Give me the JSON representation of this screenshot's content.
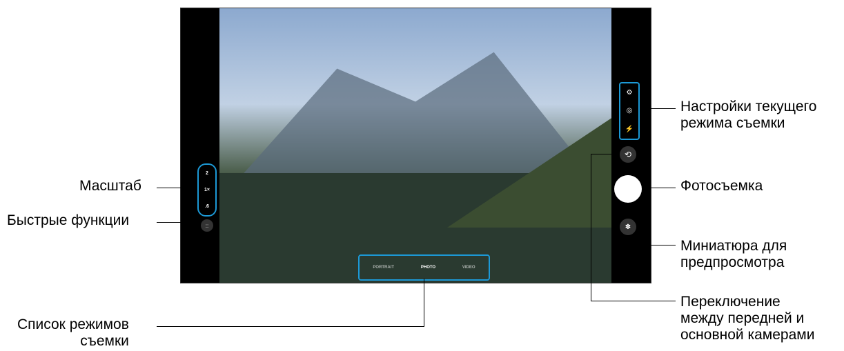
{
  "labels": {
    "zoom": "Масштаб",
    "quick_funcs": "Быстрые функции",
    "mode_list": "Список режимов\nсъемки",
    "settings": "Настройки текущего\nрежима съемки",
    "capture": "Фотосъемка",
    "thumbnail": "Миниатюра для\nпредпросмотра",
    "switch_camera": "Переключение\nмежду передней и\nосновной камерами"
  },
  "ui_values": {
    "zoom_levels": [
      "2",
      "1×",
      ".6"
    ],
    "modes": [
      "PORTRAIT",
      "PHOTO",
      "VIDEO"
    ],
    "quick_icon": "::",
    "settings_icons": [
      "⚙",
      "◎",
      "⚡"
    ],
    "switch_icon": "⟲",
    "thumbnail_icon": "✽"
  }
}
